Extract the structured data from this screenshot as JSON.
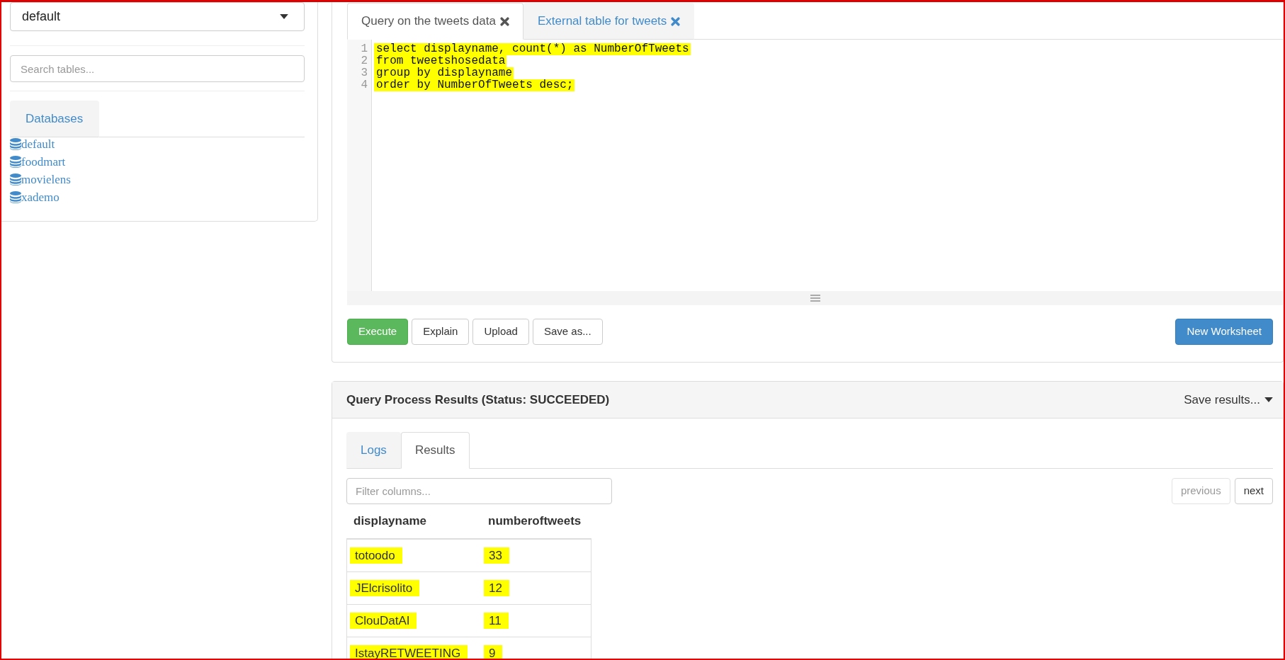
{
  "sidebar": {
    "database_select": {
      "value": "default"
    },
    "table_search": {
      "placeholder": "Search tables..."
    },
    "tabs": [
      {
        "label": "Databases",
        "selected": false
      }
    ],
    "databases": [
      "default",
      "foodmart",
      "movielens",
      "xademo"
    ]
  },
  "query_tabs": [
    {
      "label": "Query on the tweets data",
      "selected": true
    },
    {
      "label": "External table for tweets",
      "selected": false
    }
  ],
  "editor": {
    "lines": [
      {
        "number": "1",
        "code": "select displayname, count(*) as NumberOfTweets",
        "highlighted": true
      },
      {
        "number": "2",
        "code": "from tweetshosedata",
        "highlighted": true
      },
      {
        "number": "3",
        "code": "group by displayname",
        "highlighted": true
      },
      {
        "number": "4",
        "code": "order by NumberOfTweets desc;",
        "highlighted": true
      }
    ]
  },
  "actions": [
    {
      "label": "Execute",
      "kind": "success"
    },
    {
      "label": "Explain",
      "kind": "default"
    },
    {
      "label": "Upload",
      "kind": "default"
    },
    {
      "label": "Save as...",
      "kind": "default"
    },
    {
      "label": "New Worksheet",
      "kind": "primary"
    }
  ],
  "results": {
    "title": "Query Process Results (Status: SUCCEEDED)",
    "save_menu": {
      "label": "Save results..."
    },
    "tabs": [
      {
        "label": "Logs",
        "selected": false
      },
      {
        "label": "Results",
        "selected": true
      }
    ],
    "filter": {
      "placeholder": "Filter columns..."
    },
    "pager": [
      {
        "label": "previous",
        "disabled": true
      },
      {
        "label": "next",
        "disabled": false
      }
    ],
    "table": {
      "columns": [
        "displayname",
        "numberoftweets"
      ],
      "rows": [
        {
          "cells": [
            "totoodo",
            "33"
          ],
          "highlighted": true
        },
        {
          "cells": [
            "JElcrisolito",
            "12"
          ],
          "highlighted": true
        },
        {
          "cells": [
            "ClouDatAI",
            "11"
          ],
          "highlighted": true
        },
        {
          "cells": [
            "IstayRETWEETING",
            "9"
          ],
          "highlighted": true
        }
      ]
    }
  }
}
